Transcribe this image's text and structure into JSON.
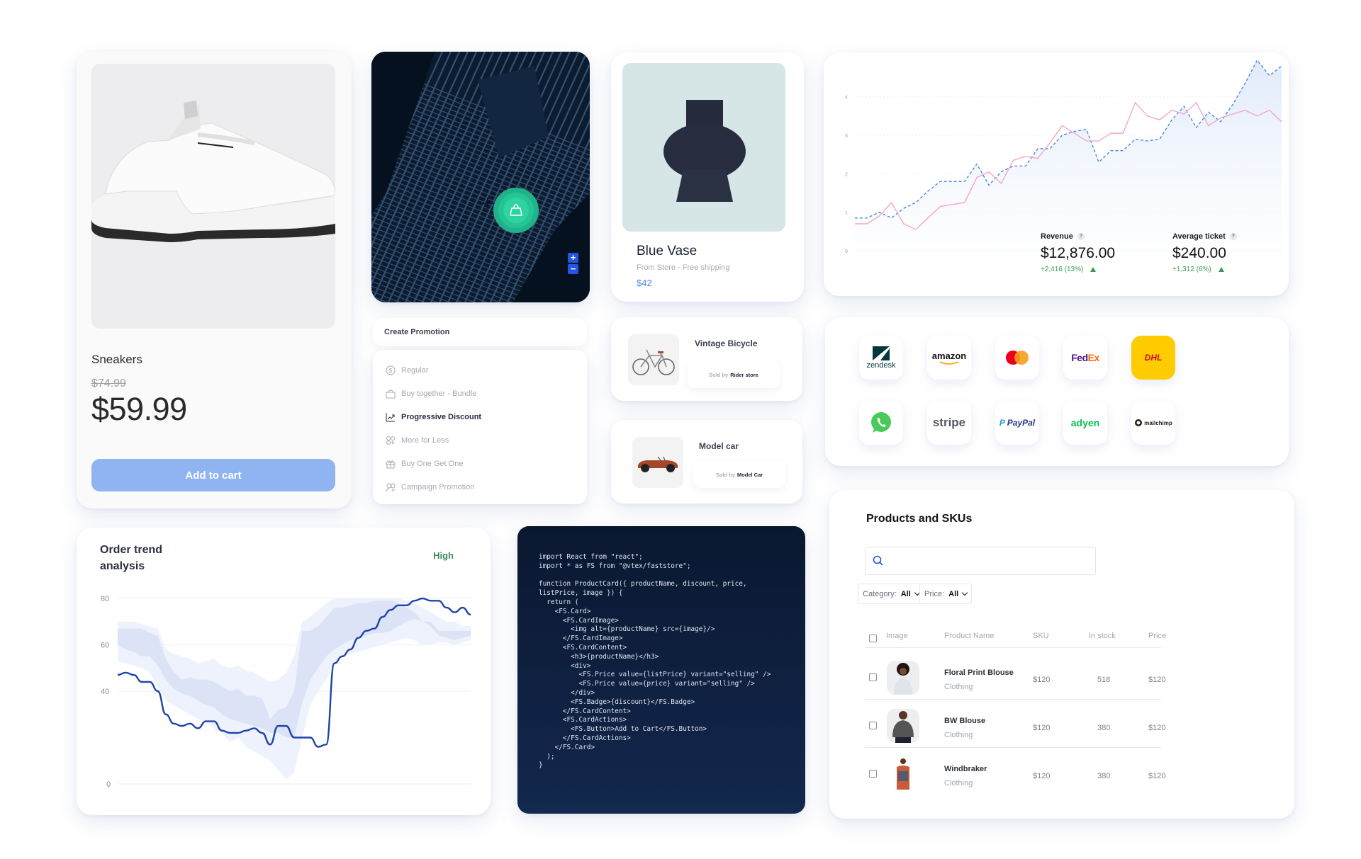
{
  "sneaker_card": {
    "name": "Sneakers",
    "list_price": "$74.99",
    "price": "$59.99",
    "add_to_cart": "Add to cart",
    "image": "sneaker-image"
  },
  "map": {
    "marker_icon": "shopping-bag-icon",
    "zoom_in": "+",
    "zoom_out": "−"
  },
  "vase_card": {
    "name": "Blue Vase",
    "subtitle": "From Store - Free shipping",
    "price": "$42",
    "image": "vase-image"
  },
  "revenue_widget": {
    "chart_data": {
      "type": "line",
      "title": "",
      "xlabel": "",
      "ylabel": "",
      "ylim": [
        0,
        4.6
      ],
      "yticks": [
        "0",
        "1",
        "2",
        "3",
        "4"
      ],
      "grid": true,
      "series": [
        {
          "name": "Blue (dashed, filled)",
          "color": "#4a86e8",
          "style": "dashed",
          "values": [
            0.85,
            0.85,
            1.0,
            0.85,
            1.1,
            1.25,
            1.55,
            1.8,
            1.8,
            1.8,
            2.25,
            1.7,
            2.05,
            2.2,
            2.2,
            2.65,
            2.65,
            3.0,
            3.1,
            3.15,
            2.3,
            2.6,
            2.6,
            2.9,
            2.85,
            2.9,
            3.4,
            3.75,
            3.2,
            3.6,
            3.35,
            3.8,
            4.35,
            4.95,
            4.55,
            4.8
          ]
        },
        {
          "name": "Pink (solid)",
          "color": "#f4a7c3",
          "style": "solid",
          "values": [
            0.7,
            0.7,
            0.9,
            1.25,
            0.7,
            0.55,
            0.85,
            1.15,
            1.2,
            1.25,
            1.9,
            2.05,
            1.75,
            2.35,
            2.45,
            2.4,
            2.8,
            3.25,
            3.05,
            2.85,
            2.85,
            3.05,
            3.05,
            3.85,
            3.5,
            3.4,
            3.65,
            3.55,
            3.85,
            3.25,
            3.45,
            3.55,
            3.65,
            3.5,
            3.65,
            3.35
          ]
        }
      ]
    },
    "kpis": [
      {
        "label": "Revenue",
        "value": "$12,876.00",
        "delta": "+2,416 (13%)",
        "trend": "up"
      },
      {
        "label": "Average ticket",
        "value": "$240.00",
        "delta": "+1,312 (6%)",
        "trend": "up"
      }
    ]
  },
  "create_promotion": {
    "title": "Create Promotion",
    "items": [
      {
        "label": "Regular",
        "icon": "dollar-circle-icon",
        "active": false
      },
      {
        "label": "Buy together - Bundle",
        "icon": "shopping-bag-icon",
        "active": false
      },
      {
        "label": "Progressive Discount",
        "icon": "trending-chart-icon",
        "active": true
      },
      {
        "label": "More for Less",
        "icon": "circles-plus-icon",
        "active": false
      },
      {
        "label": "Buy One Get One",
        "icon": "gift-icon",
        "active": false
      },
      {
        "label": "Campaign Promotion",
        "icon": "users-icon",
        "active": false
      }
    ]
  },
  "marketplace": [
    {
      "title": "Vintage Bicycle",
      "sold_by_label": "Sold by",
      "seller": "Rider store",
      "image": "bicycle-image"
    },
    {
      "title": "Model car",
      "sold_by_label": "Sold by",
      "seller": "Model Car",
      "image": "model-car-image"
    }
  ],
  "integrations": [
    {
      "name": "zendesk",
      "label": "zendesk"
    },
    {
      "name": "amazon",
      "label": "amazon"
    },
    {
      "name": "mastercard",
      "label": ""
    },
    {
      "name": "fedex",
      "label": "FedEx"
    },
    {
      "name": "dhl",
      "label": "DHL"
    },
    {
      "name": "whatsapp",
      "label": ""
    },
    {
      "name": "stripe",
      "label": "stripe"
    },
    {
      "name": "paypal",
      "label": "PayPal"
    },
    {
      "name": "adyen",
      "label": "adyen"
    },
    {
      "name": "mailchimp",
      "label": "mailchimp"
    }
  ],
  "order_trend": {
    "title": "Order trend analysis",
    "status": "High",
    "chart_data": {
      "type": "area",
      "title": "Order trend analysis",
      "xlabel": "",
      "ylabel": "",
      "ylim": [
        0,
        80
      ],
      "yticks": [
        "0",
        "40",
        "60",
        "80"
      ],
      "grid": true,
      "series": [
        {
          "name": "Actual",
          "color": "#1f44a8",
          "values": [
            47,
            48,
            47,
            44,
            44,
            40,
            30,
            26,
            25,
            26,
            24,
            27,
            27,
            23,
            22,
            22,
            23,
            24,
            22,
            17,
            25,
            25,
            20,
            20,
            20,
            16,
            17,
            52,
            55,
            58,
            63,
            66,
            67,
            72,
            75,
            77,
            77,
            79,
            80,
            79,
            79,
            76,
            74,
            76,
            73
          ]
        },
        {
          "name": "Inner band upper",
          "values": [
            67,
            67,
            67,
            67,
            65,
            64,
            54,
            48,
            45,
            46,
            45,
            45,
            44,
            42,
            40,
            41,
            38,
            38,
            37,
            28,
            32,
            33,
            40,
            66,
            66,
            68,
            72,
            76,
            76,
            77,
            78,
            78,
            79,
            79,
            79,
            78,
            76,
            74,
            70,
            70,
            66,
            66,
            66,
            66,
            66
          ]
        },
        {
          "name": "Inner band lower",
          "values": [
            60,
            58,
            57,
            55,
            55,
            51,
            45,
            41,
            39,
            38,
            36,
            34,
            33,
            30,
            28,
            27,
            26,
            25,
            24,
            22,
            22,
            20,
            20,
            35,
            45,
            50,
            55,
            58,
            60,
            62,
            63,
            64,
            65,
            65,
            66,
            68,
            70,
            71,
            70,
            68,
            64,
            63,
            62,
            63,
            64
          ]
        },
        {
          "name": "Outer band upper",
          "values": [
            70,
            70,
            70,
            69,
            68,
            67,
            58,
            56,
            55,
            54,
            52,
            53,
            54,
            51,
            50,
            51,
            49,
            48,
            46,
            44,
            45,
            48,
            55,
            70,
            72,
            75,
            78,
            80,
            80,
            80,
            80,
            80,
            80,
            80,
            80,
            80,
            79,
            78,
            76,
            74,
            72,
            70,
            70,
            68,
            68
          ]
        },
        {
          "name": "Outer band lower",
          "values": [
            53,
            52,
            51,
            50,
            48,
            42,
            36,
            34,
            32,
            30,
            28,
            27,
            24,
            22,
            18,
            20,
            16,
            14,
            12,
            10,
            6,
            2,
            5,
            20,
            34,
            40,
            45,
            52,
            55,
            56,
            57,
            58,
            59,
            60,
            61,
            62,
            63,
            62,
            60,
            60,
            61,
            61,
            60,
            61,
            62
          ]
        }
      ]
    }
  },
  "code_sample": {
    "lines": [
      "import React from \"react\";",
      "import * as FS from \"@vtex/faststore\";",
      "",
      "function ProductCard({ productName, discount, price,",
      "listPrice, image }) {",
      "  return (",
      "    <FS.Card>",
      "      <FS.CardImage>",
      "        <img alt={productName} src={image}/>",
      "      </FS.CardImage>",
      "      <FS.CardContent>",
      "        <h3>{productName}</h3>",
      "        <div>",
      "          <FS.Price value={listPrice} variant=\"selling\" />",
      "          <FS.Price value={price} variant=\"selling\" />",
      "        </div>",
      "        <FS.Badge>{discount}</FS.Badge>",
      "      </FS.CardContent>",
      "      <FS.CardActions>",
      "        <FS.Button>Add to Cart</FS.Button>",
      "      </FS.CardActions>",
      "    </FS.Card>",
      "  );",
      "}"
    ]
  },
  "products_table": {
    "title": "Products and SKUs",
    "search": {
      "value": "",
      "placeholder": ""
    },
    "filters": [
      {
        "label": "Category:",
        "value": "All"
      },
      {
        "label": "Price:",
        "value": "All"
      }
    ],
    "columns": [
      "Image",
      "Product Name",
      "SKU",
      "In stock",
      "Price"
    ],
    "rows": [
      {
        "name": "Floral Print Blouse",
        "category": "Clothing",
        "sku": "$120",
        "in_stock": "518",
        "price": "$120"
      },
      {
        "name": "BW Blouse",
        "category": "Clothing",
        "sku": "$120",
        "in_stock": "380",
        "price": "$120"
      },
      {
        "name": "Windbraker",
        "category": "Clothing",
        "sku": "$120",
        "in_stock": "380",
        "price": "$120"
      }
    ]
  }
}
